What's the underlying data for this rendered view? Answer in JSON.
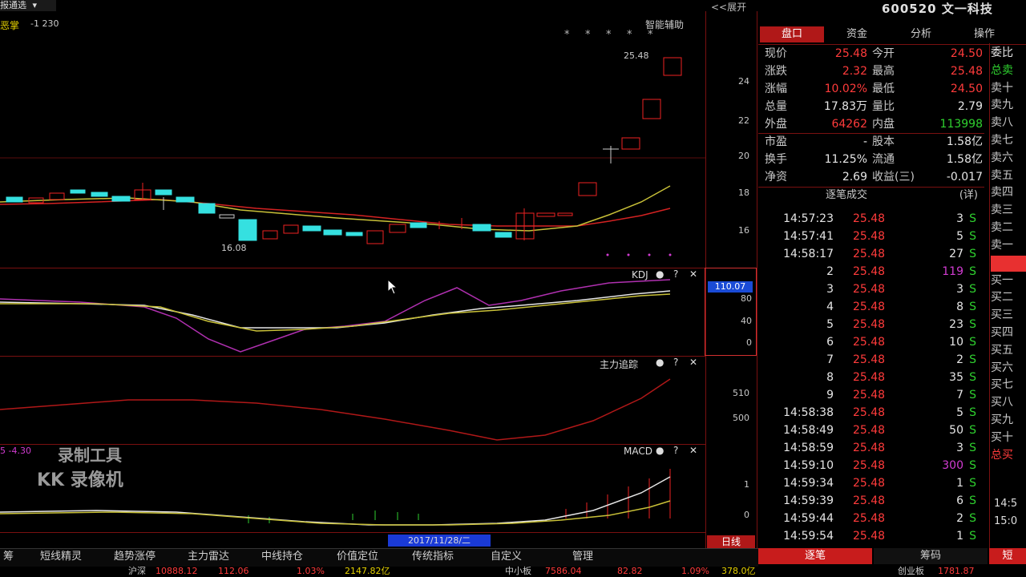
{
  "top": {
    "period_label": "报通选",
    "period_dropdown": "▾",
    "expand_label": "<<展开",
    "stock_title": "600520 文一科技"
  },
  "main_chart": {
    "indicator_label": "恶掌",
    "indicator_value": "-1 230",
    "smart_assist": "智能辅助",
    "high_label": "25.48",
    "low_label": "16.08",
    "y_ticks": [
      "24",
      "22",
      "20",
      "18",
      "16"
    ],
    "stars": [
      "*",
      "*",
      "*",
      "*",
      "*"
    ]
  },
  "sub1": {
    "name": "KDJ",
    "scale_highlight": "110.07",
    "y_ticks": [
      "80",
      "40",
      "0"
    ]
  },
  "sub2": {
    "name": "主力追踪",
    "y_ticks": [
      "510",
      "500"
    ]
  },
  "sub3": {
    "name": "MACD",
    "left_value": "5  -4.30",
    "y_ticks": [
      "1",
      "0"
    ]
  },
  "watermark": {
    "line1": "录制工具",
    "line2": "KK 录像机"
  },
  "date_badge": "2017/11/28/二",
  "day_label": "日线",
  "right_tabs": [
    "盘口",
    "资金",
    "分析",
    "操作"
  ],
  "quote": [
    {
      "l1": "现价",
      "v1": "25.48",
      "c1": "red",
      "l2": "今开",
      "v2": "24.50",
      "c2": "red"
    },
    {
      "l1": "涨跌",
      "v1": "2.32",
      "c1": "red",
      "l2": "最高",
      "v2": "25.48",
      "c2": "red"
    },
    {
      "l1": "涨幅",
      "v1": "10.02%",
      "c1": "red",
      "l2": "最低",
      "v2": "24.50",
      "c2": "red"
    },
    {
      "l1": "总量",
      "v1": "17.83万",
      "c1": "white",
      "l2": "量比",
      "v2": "2.79",
      "c2": "white"
    },
    {
      "l1": "外盘",
      "v1": "64262",
      "c1": "red",
      "l2": "内盘",
      "v2": "113998",
      "c2": "green"
    },
    {
      "l1": "市盈",
      "v1": "-",
      "c1": "white",
      "l2": "股本",
      "v2": "1.58亿",
      "c2": "white"
    },
    {
      "l1": "换手",
      "v1": "11.25%",
      "c1": "white",
      "l2": "流通",
      "v2": "1.58亿",
      "c2": "white"
    },
    {
      "l1": "净资",
      "v1": "2.69",
      "c1": "white",
      "l2": "收益(三)",
      "v2": "-0.017",
      "c2": "white"
    }
  ],
  "trades_header": {
    "title": "逐笔成交",
    "detail": "(详)"
  },
  "trades": [
    {
      "time": "14:57:23",
      "price": "25.48",
      "vol": "3",
      "vc": "white",
      "flag": "S"
    },
    {
      "time": "14:57:41",
      "price": "25.48",
      "vol": "5",
      "vc": "white",
      "flag": "S"
    },
    {
      "time": "14:58:17",
      "price": "25.48",
      "vol": "27",
      "vc": "white",
      "flag": "S"
    },
    {
      "time": "2",
      "price": "25.48",
      "vol": "119",
      "vc": "magenta",
      "flag": "S"
    },
    {
      "time": "3",
      "price": "25.48",
      "vol": "3",
      "vc": "white",
      "flag": "S"
    },
    {
      "time": "4",
      "price": "25.48",
      "vol": "8",
      "vc": "white",
      "flag": "S"
    },
    {
      "time": "5",
      "price": "25.48",
      "vol": "23",
      "vc": "white",
      "flag": "S"
    },
    {
      "time": "6",
      "price": "25.48",
      "vol": "10",
      "vc": "white",
      "flag": "S"
    },
    {
      "time": "7",
      "price": "25.48",
      "vol": "2",
      "vc": "white",
      "flag": "S"
    },
    {
      "time": "8",
      "price": "25.48",
      "vol": "35",
      "vc": "white",
      "flag": "S"
    },
    {
      "time": "9",
      "price": "25.48",
      "vol": "7",
      "vc": "white",
      "flag": "S"
    },
    {
      "time": "14:58:38",
      "price": "25.48",
      "vol": "5",
      "vc": "white",
      "flag": "S"
    },
    {
      "time": "14:58:49",
      "price": "25.48",
      "vol": "50",
      "vc": "white",
      "flag": "S"
    },
    {
      "time": "14:58:59",
      "price": "25.48",
      "vol": "3",
      "vc": "white",
      "flag": "S"
    },
    {
      "time": "14:59:10",
      "price": "25.48",
      "vol": "300",
      "vc": "magenta",
      "flag": "S"
    },
    {
      "time": "14:59:34",
      "price": "25.48",
      "vol": "1",
      "vc": "white",
      "flag": "S"
    },
    {
      "time": "14:59:39",
      "price": "25.48",
      "vol": "6",
      "vc": "white",
      "flag": "S"
    },
    {
      "time": "14:59:44",
      "price": "25.48",
      "vol": "2",
      "vc": "white",
      "flag": "S"
    },
    {
      "time": "14:59:54",
      "price": "25.48",
      "vol": "1",
      "vc": "white",
      "flag": "S"
    }
  ],
  "right_strip": {
    "items": [
      "委比",
      "总卖",
      "卖十",
      "卖九",
      "卖八",
      "卖七",
      "卖六",
      "卖五",
      "卖四",
      "卖三",
      "卖二",
      "卖一",
      "",
      "买一",
      "买二",
      "买三",
      "买四",
      "买五",
      "买六",
      "买七",
      "买八",
      "买九",
      "买十",
      "总买"
    ],
    "times": [
      "14:5",
      "15:0"
    ]
  },
  "bottom_tabs": [
    "筹",
    "短线精灵",
    "趋势涨停",
    "主力雷达",
    "中线持仓",
    "价值定位",
    "传统指标",
    "自定义",
    "管理"
  ],
  "bottom_right_tabs": [
    "逐笔",
    "筹码",
    "短"
  ],
  "ticker": {
    "s1_name": "沪深",
    "s1_val": "10888.12",
    "s1_chg": "112.06",
    "s1_pct": "1.03%",
    "s1_amt": "2147.82亿",
    "s2_name": "中小板",
    "s2_val": "7586.04",
    "s2_chg": "82.82",
    "s2_pct": "1.09%",
    "s2_amt": "378.0亿",
    "s3_name": "创业板",
    "s3_val": "1781.87"
  }
}
